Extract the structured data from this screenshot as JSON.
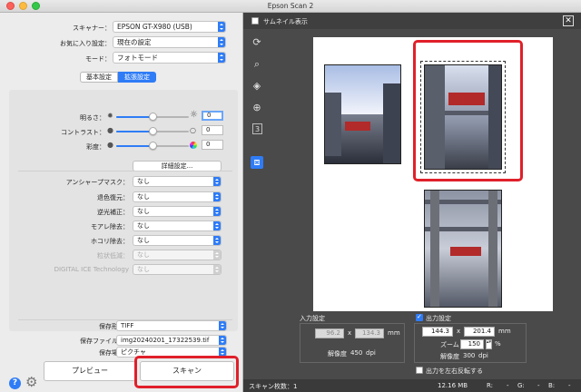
{
  "window": {
    "title": "Epson Scan 2"
  },
  "settings": {
    "scanner": {
      "label": "スキャナー：",
      "value": "EPSON GT-X980 (USB)"
    },
    "favorite": {
      "label": "お気に入り設定：",
      "value": "現在の設定"
    },
    "mode": {
      "label": "モード：",
      "value": "フォトモード"
    }
  },
  "tabs": [
    {
      "label": "基本設定",
      "active": false
    },
    {
      "label": "拡張設定",
      "active": true
    }
  ],
  "adjustments": {
    "brightness": {
      "label": "明るさ：",
      "value": "0",
      "level_percent": 50
    },
    "contrast": {
      "label": "コントラスト：",
      "value": "0",
      "level_percent": 50
    },
    "saturation": {
      "label": "彩度：",
      "value": "0",
      "level_percent": 50
    },
    "detail_button": "詳細設定..."
  },
  "enhancements": [
    {
      "label": "アンシャープマスク：",
      "value": "なし",
      "enabled": true
    },
    {
      "label": "退色復元：",
      "value": "なし",
      "enabled": true
    },
    {
      "label": "逆光補正：",
      "value": "なし",
      "enabled": true
    },
    {
      "label": "モアレ除去：",
      "value": "なし",
      "enabled": true
    },
    {
      "label": "ホコリ除去：",
      "value": "なし",
      "enabled": true
    },
    {
      "label": "粒状低減：",
      "value": "なし",
      "enabled": false
    },
    {
      "label": "DIGITAL ICE Technology",
      "value": "なし",
      "enabled": false
    }
  ],
  "output": {
    "format": {
      "label": "保存形式：",
      "value": "TIFF"
    },
    "filename": {
      "label": "保存ファイル名：",
      "value": "img20240201_17322539.tif"
    },
    "location": {
      "label": "保存場所：",
      "value": "ピクチャ"
    }
  },
  "buttons": {
    "preview": "プレビュー",
    "scan": "スキャン"
  },
  "preview": {
    "thumbnail_label": "サムネイル表示",
    "thumbnail_checked": false,
    "input": {
      "label": "入力設定",
      "width": "96.2",
      "height": "134.3",
      "unit": "mm",
      "resolution_label": "解像度",
      "resolution": "450",
      "resolution_unit": "dpi"
    },
    "output": {
      "label": "出力設定",
      "checked": true,
      "width": "144.3",
      "height": "201.4",
      "unit": "mm",
      "zoom_label": "ズーム",
      "zoom": "150",
      "zoom_unit": "%",
      "resolution_label": "解像度",
      "resolution": "300",
      "resolution_unit": "dpi",
      "times": "x"
    },
    "mirror_label": "出力を左右反転する",
    "mirror_checked": false
  },
  "status": {
    "scan_count": "スキャン枚数：1",
    "file_size": "12.16 MB",
    "r": "R:",
    "g": "G:",
    "b": "B:",
    "r_value": "-",
    "g_value": "-",
    "b_value": "-"
  },
  "colors": {
    "accent": "#2f7cf6",
    "highlight": "#e0202a",
    "preview_bg": "#4a4a4a"
  }
}
